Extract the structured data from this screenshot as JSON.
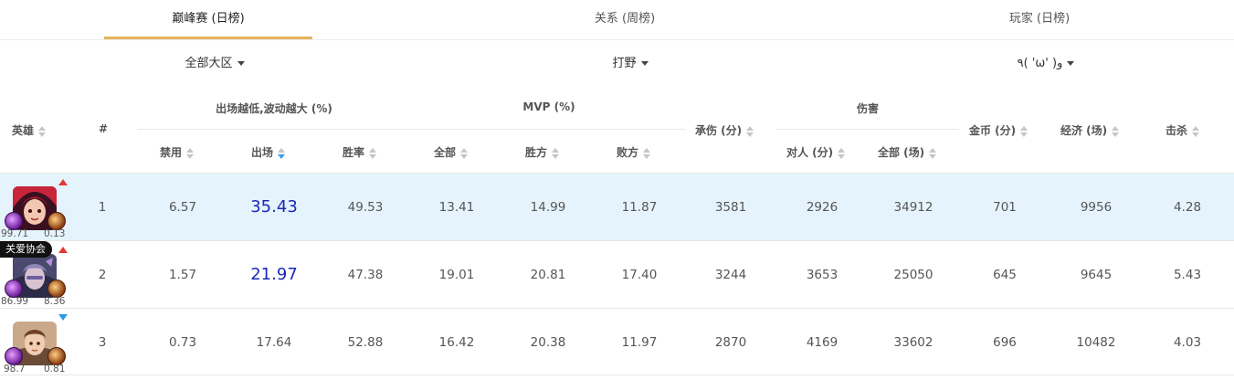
{
  "tabs": [
    {
      "label": "巅峰赛 (日榜)",
      "active": true
    },
    {
      "label": "关系 (周榜)",
      "active": false
    },
    {
      "label": "玩家 (日榜)",
      "active": false
    }
  ],
  "filters": {
    "region": "全部大区",
    "position": "打野",
    "extra": "٩( 'ω' )و"
  },
  "header": {
    "hero": "英雄",
    "rank": "#",
    "group_pick": "出场越低,波动越大 (%)",
    "ban": "禁用",
    "pick": "出场",
    "winrate": "胜率",
    "group_mvp": "MVP (%)",
    "mvp_all": "全部",
    "mvp_win": "胜方",
    "mvp_lose": "败方",
    "tank": "承伤 (分)",
    "group_damage": "伤害",
    "dmg_hero": "对人 (分)",
    "dmg_all": "全部 (场)",
    "gold": "金币 (分)",
    "economy": "经济 (场)",
    "kills": "击杀"
  },
  "rows": [
    {
      "rank": "1",
      "trend": "up",
      "badge": "",
      "spell_left": "99.71",
      "spell_right": "0.13",
      "ban": "6.57",
      "pick": "35.43",
      "winrate": "49.53",
      "mvp_all": "13.41",
      "mvp_win": "14.99",
      "mvp_lose": "11.87",
      "tank": "3581",
      "dmg_hero": "2926",
      "dmg_all": "34912",
      "gold": "701",
      "economy": "9956",
      "kills": "4.28",
      "highlight": true
    },
    {
      "rank": "2",
      "trend": "up",
      "badge": "关爱协会",
      "spell_left": "86.99",
      "spell_right": "8.36",
      "ban": "1.57",
      "pick": "21.97",
      "winrate": "47.38",
      "mvp_all": "19.01",
      "mvp_win": "20.81",
      "mvp_lose": "17.40",
      "tank": "3244",
      "dmg_hero": "3653",
      "dmg_all": "25050",
      "gold": "645",
      "economy": "9645",
      "kills": "5.43",
      "highlight": false
    },
    {
      "rank": "3",
      "trend": "down",
      "badge": "",
      "spell_left": "98.7",
      "spell_right": "0.81",
      "ban": "0.73",
      "pick": "17.64",
      "winrate": "52.88",
      "mvp_all": "16.42",
      "mvp_win": "20.38",
      "mvp_lose": "11.97",
      "tank": "2870",
      "dmg_hero": "4169",
      "dmg_all": "33602",
      "gold": "696",
      "economy": "10482",
      "kills": "4.03",
      "highlight": false
    }
  ],
  "colors": {
    "accent_underline": "#e2b35a",
    "row_highlight": "#e5f4fc",
    "pick_emphasis": "#1a28b8",
    "sort_active": "#3a9ff0",
    "trend_up": "#e53935",
    "trend_down": "#2a9be0"
  }
}
